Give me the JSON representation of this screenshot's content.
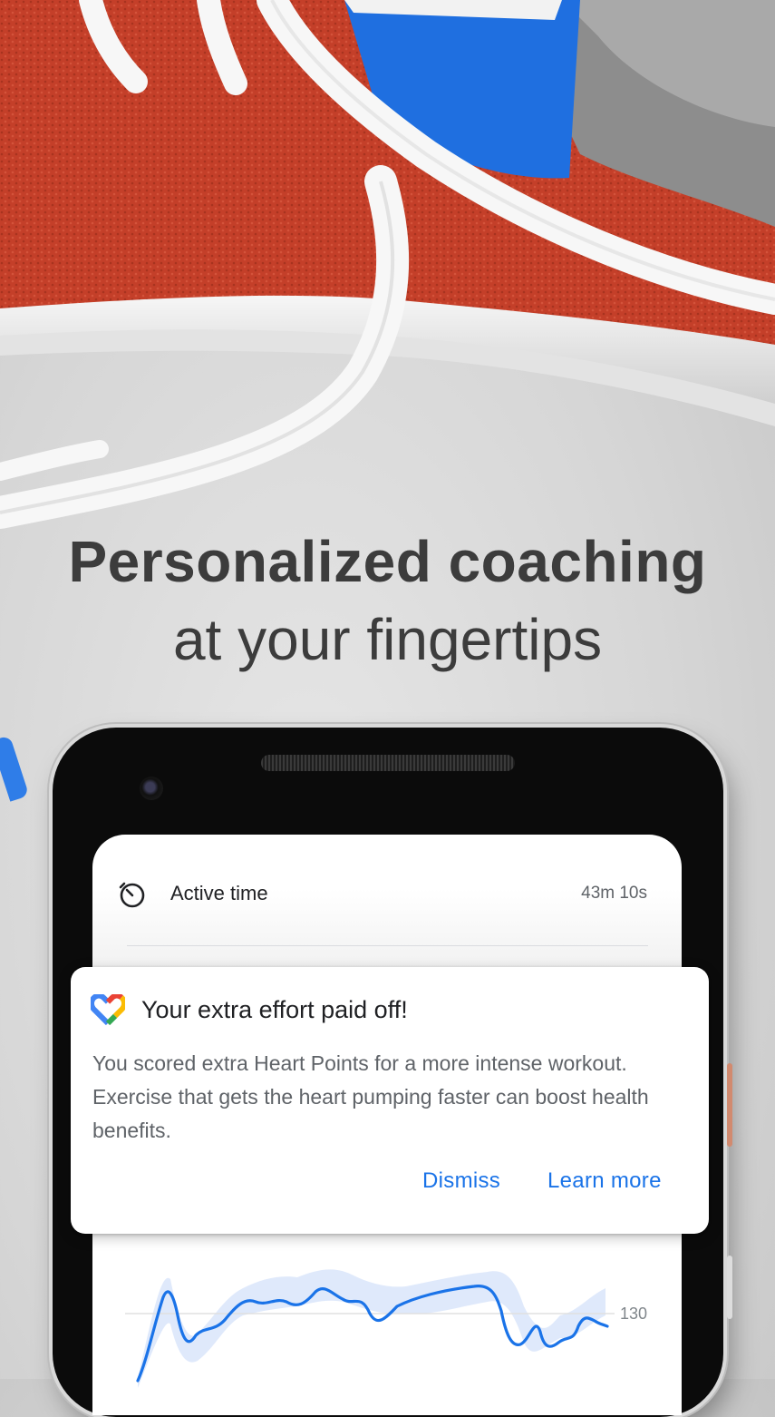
{
  "headline": {
    "line1": "Personalized coaching",
    "line2": "at your fingertips"
  },
  "screen": {
    "metric": {
      "icon": "timer-icon",
      "label": "Active time",
      "value": "43m 10s"
    },
    "chart_label": "130"
  },
  "notification": {
    "icon": "google-fit-heart-icon",
    "title": "Your extra effort paid off!",
    "body": "You scored extra Heart Points for a more intense workout. Exercise that gets the heart pumping faster can boost health benefits.",
    "actions": {
      "dismiss": "Dismiss",
      "learn_more": "Learn more"
    }
  },
  "colors": {
    "accent_blue": "#1a73e8",
    "shoe_red": "#c8402a",
    "shoe_blue": "#1f6fe0",
    "headline": "#3c3c3c"
  }
}
